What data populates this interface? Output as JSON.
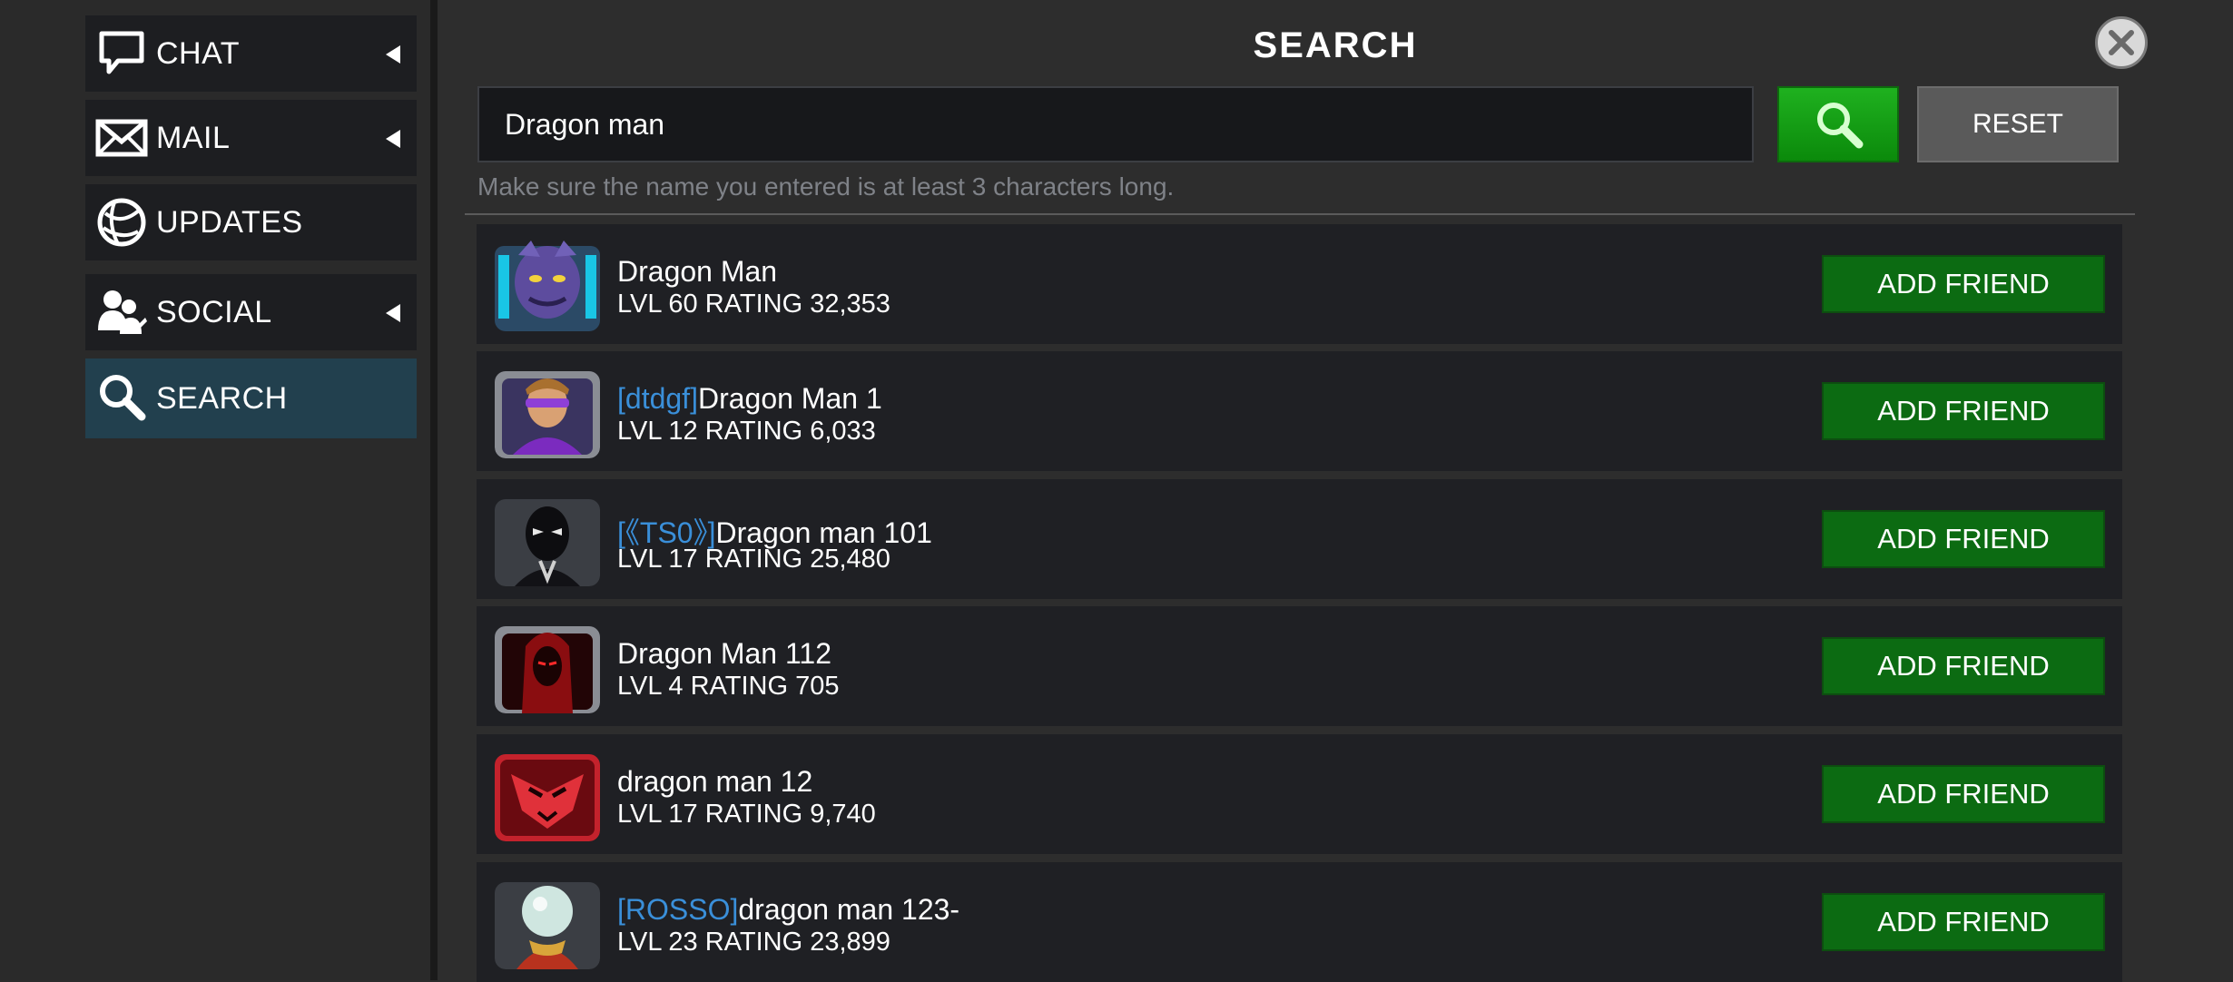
{
  "sidebar": {
    "items": [
      {
        "label": "CHAT",
        "icon": "chat-bubble-icon",
        "has_arrow": true
      },
      {
        "label": "MAIL",
        "icon": "envelope-icon",
        "has_arrow": true
      },
      {
        "label": "UPDATES",
        "icon": "globe-icon",
        "has_arrow": false
      },
      {
        "label": "SOCIAL",
        "icon": "users-icon",
        "has_arrow": true
      },
      {
        "label": "SEARCH",
        "icon": "magnifier-icon",
        "has_arrow": false,
        "active": true
      }
    ]
  },
  "header": {
    "title": "SEARCH",
    "close_icon": "close-icon"
  },
  "search": {
    "value": "Dragon man",
    "placeholder": "",
    "button_icon": "magnifier-icon",
    "reset_label": "RESET",
    "hint": "Make sure the name you entered is at least 3 characters long."
  },
  "results": [
    {
      "alliance": "",
      "name": "Dragon Man",
      "stats": "LVL 60  RATING 32,353",
      "button": "ADD FRIEND",
      "avatar": "dragon-man-portrait"
    },
    {
      "alliance": "[dtdgf]",
      "name": "Dragon Man 1",
      "stats": "LVL 12  RATING 6,033",
      "button": "ADD FRIEND",
      "avatar": "hawkeye-portrait"
    },
    {
      "alliance": "[《TS0》]",
      "name": "Dragon man 101",
      "stats": "LVL 17  RATING 25,480",
      "button": "ADD FRIEND",
      "avatar": "black-suit-portrait"
    },
    {
      "alliance": "",
      "name": "Dragon Man 112",
      "stats": "LVL 4  RATING 705",
      "button": "ADD FRIEND",
      "avatar": "red-hooded-portrait"
    },
    {
      "alliance": "",
      "name": "dragon man 12",
      "stats": "LVL 17  RATING 9,740",
      "button": "ADD FRIEND",
      "avatar": "red-mask-portrait"
    },
    {
      "alliance": "[ROSSO]",
      "name": "dragon man 123-",
      "stats": "LVL 23  RATING 23,899",
      "button": "ADD FRIEND",
      "avatar": "mysterio-portrait"
    }
  ],
  "colors": {
    "alliance_tag": "#3a8fd9",
    "add_button": "#0c6b12",
    "active_nav": "#22404e",
    "search_button": "#16a016"
  }
}
